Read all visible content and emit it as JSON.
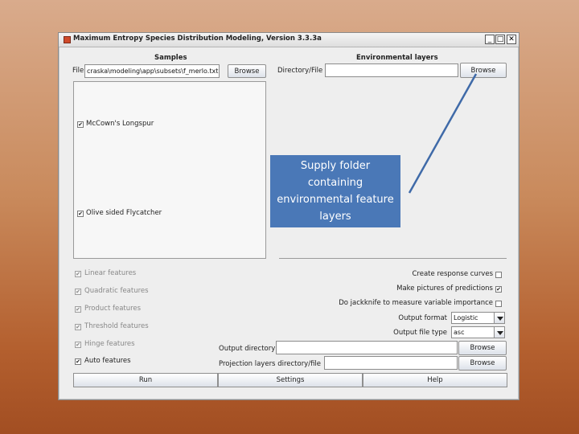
{
  "window": {
    "title": "Maximum Entropy Species Distribution Modeling, Version 3.3.3a",
    "min": "_",
    "max": "□",
    "close": "✕"
  },
  "samples": {
    "header": "Samples",
    "file_label": "File",
    "file_value": "craska\\modeling\\app\\subsets\\f_merlo.txt",
    "browse_label": "Browse",
    "species": [
      {
        "label": "McCown's Longspur",
        "checked": "✔"
      },
      {
        "label": "Olive sided Flycatcher",
        "checked": "✔"
      }
    ]
  },
  "environment": {
    "header": "Environmental layers",
    "dir_label": "Directory/File",
    "dir_value": "",
    "browse_label": "Browse"
  },
  "features": [
    {
      "label": "Linear features",
      "checked": "✔"
    },
    {
      "label": "Quadratic features",
      "checked": "✔"
    },
    {
      "label": "Product features",
      "checked": "✔"
    },
    {
      "label": "Threshold features",
      "checked": "✔"
    },
    {
      "label": "Hinge features",
      "checked": "✔"
    },
    {
      "label": "Auto features",
      "checked": "✔"
    }
  ],
  "options": {
    "response_curves": {
      "label": "Create response curves",
      "checked": ""
    },
    "pictures": {
      "label": "Make pictures of predictions",
      "checked": "✔"
    },
    "jackknife": {
      "label": "Do jackknife to measure variable importance",
      "checked": ""
    },
    "output_format": {
      "label": "Output format",
      "value": "Logistic"
    },
    "output_file_type": {
      "label": "Output file type",
      "value": "asc"
    },
    "output_directory": {
      "label": "Output directory",
      "value": "",
      "browse_label": "Browse"
    },
    "projection": {
      "label": "Projection layers directory/file",
      "value": "",
      "browse_label": "Browse"
    }
  },
  "bottom_buttons": {
    "run": "Run",
    "settings": "Settings",
    "help": "Help"
  },
  "callout": {
    "text": "Supply folder containing environmental feature layers",
    "color": "#4a78b7"
  }
}
